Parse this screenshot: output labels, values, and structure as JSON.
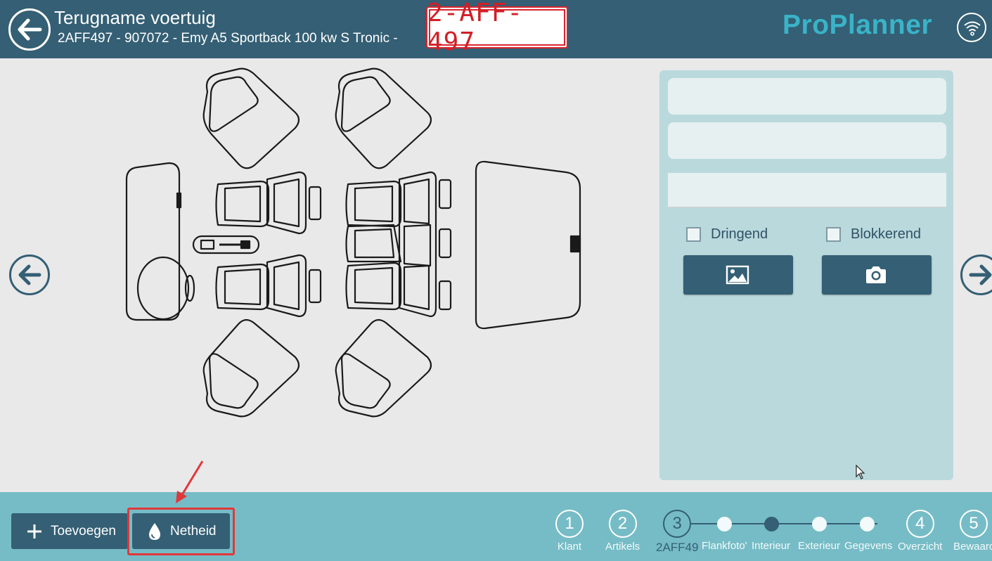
{
  "header": {
    "title": "Terugname voertuig",
    "subtitle": "2AFF497 - 907072 - Emy A5 Sportback 100 kw S Tronic -",
    "plate": "2-AFF-497",
    "brand": "ProPlanner",
    "back_icon": "arrow-left-icon",
    "wifi_icon": "wifi-icon"
  },
  "panel": {
    "checkbox_urgent": "Dringend",
    "checkbox_blocking": "Blokkerend",
    "image_icon": "image-icon",
    "camera_icon": "camera-icon"
  },
  "footer": {
    "add_label": "Toevoegen",
    "clean_label": "Netheid",
    "steps": [
      {
        "num": "1",
        "label": "Klant"
      },
      {
        "num": "2",
        "label": "Artikels"
      },
      {
        "num": "3",
        "label": "2AFF49"
      },
      {
        "num": "4",
        "label": "Overzicht"
      },
      {
        "num": "5",
        "label": "Bewaard"
      }
    ],
    "substeps": [
      "Flankfoto'",
      "Interieur",
      "Exterieur",
      "Gegevens"
    ]
  },
  "colors": {
    "header": "#345f74",
    "footer": "#76bcc6",
    "panel": "#bad9dd",
    "brand": "#3ab3c8",
    "plate_red": "#d11f27"
  }
}
